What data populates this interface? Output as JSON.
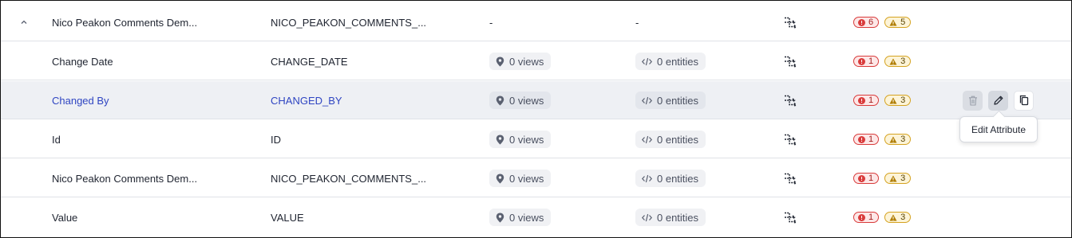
{
  "rows": [
    {
      "name": "Nico Peakon Comments Dem...",
      "technical": "NICO_PEAKON_COMMENTS_...",
      "views": "-",
      "entities": "-",
      "errors": "6",
      "warnings": "5",
      "expanded": true
    },
    {
      "name": "Change Date",
      "technical": "CHANGE_DATE",
      "views": "0 views",
      "entities": "0 entities",
      "errors": "1",
      "warnings": "3"
    },
    {
      "name": "Changed By",
      "technical": "CHANGED_BY",
      "views": "0 views",
      "entities": "0 entities",
      "errors": "1",
      "warnings": "3",
      "hovered": true
    },
    {
      "name": "Id",
      "technical": "ID",
      "views": "0 views",
      "entities": "0 entities",
      "errors": "1",
      "warnings": "3"
    },
    {
      "name": "Nico Peakon Comments Dem...",
      "technical": "NICO_PEAKON_COMMENTS_...",
      "views": "0 views",
      "entities": "0 entities",
      "errors": "1",
      "warnings": "3"
    },
    {
      "name": "Value",
      "technical": "VALUE",
      "views": "0 views",
      "entities": "0 entities",
      "errors": "1",
      "warnings": "3"
    }
  ],
  "tooltip": {
    "text": "Edit Attribute"
  },
  "icons": {
    "view": "view-pin-icon",
    "entity": "code-icon",
    "lineage": "lineage-flow-icon",
    "error": "error-circle-icon",
    "warning": "warning-triangle-icon",
    "delete": "trash-icon",
    "edit": "pencil-icon",
    "copy": "copy-icon",
    "collapse": "chevron-up-icon"
  },
  "colors": {
    "link": "#2f45c2",
    "error": "#d93b3b",
    "warning": "#d5a321",
    "hover_row": "#eef0f4"
  }
}
